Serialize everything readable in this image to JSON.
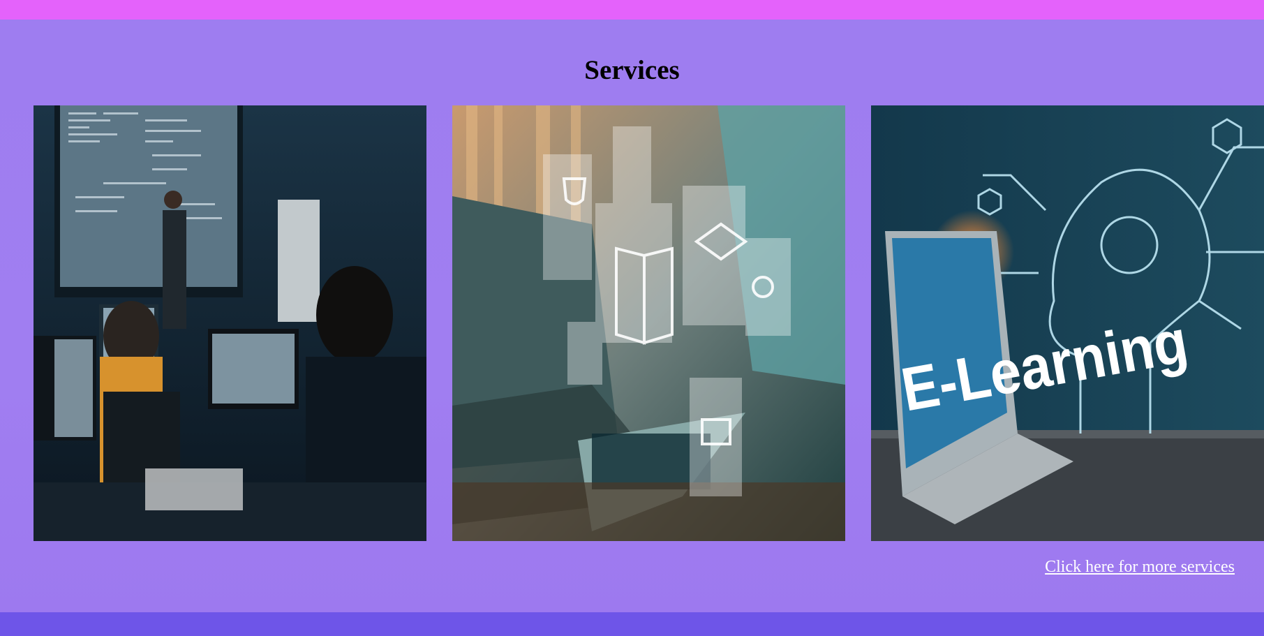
{
  "services": {
    "title": "Services",
    "cards": [
      {
        "alt": "classroom-coding-lecture",
        "icon": "presentation-image"
      },
      {
        "alt": "online-learning-laptop",
        "icon": "laptop-image"
      },
      {
        "alt": "e-learning-banner",
        "icon": "elearning-image",
        "banner_text": "E-Learning"
      }
    ],
    "more_link": "Click here for more services"
  },
  "colors": {
    "top_bar": "#e462fb",
    "background": "#a07ef0",
    "bottom_bar": "#6e55e8",
    "link": "#ffffff"
  }
}
